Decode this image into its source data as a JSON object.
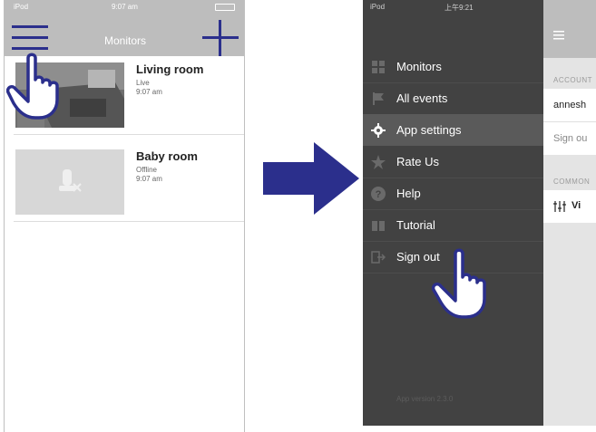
{
  "left_screen": {
    "status_bar": {
      "carrier": "iPod",
      "time": "9:07 am"
    },
    "title": "Monitors",
    "cameras": [
      {
        "name": "Living room",
        "status": "Live",
        "time": "9:07 am"
      },
      {
        "name": "Baby room",
        "status": "Offline",
        "time": "9:07 am"
      }
    ]
  },
  "right_screen": {
    "status_bar": {
      "carrier": "iPod",
      "time": "上午9:21"
    },
    "menu": [
      {
        "label": "Monitors",
        "icon": "grid-icon"
      },
      {
        "label": "All events",
        "icon": "flag-icon"
      },
      {
        "label": "App settings",
        "icon": "gear-icon",
        "active": true
      },
      {
        "label": "Rate Us",
        "icon": "star-icon"
      },
      {
        "label": "Help",
        "icon": "help-icon"
      },
      {
        "label": "Tutorial",
        "icon": "book-icon"
      },
      {
        "label": "Sign out",
        "icon": "sign-out-icon"
      }
    ],
    "app_version": "App version 2.3.0",
    "peek": {
      "account_header": "ACCOUNT",
      "account_user": "annesh",
      "sign_out": "Sign ou",
      "common_header": "COMMON",
      "video_row": "Vi"
    }
  },
  "colors": {
    "drawer_bg": "#424242",
    "active_item_bg": "#5a5a5a",
    "arrow": "#2b2f8c",
    "top_bar": "#bdbdbd"
  }
}
